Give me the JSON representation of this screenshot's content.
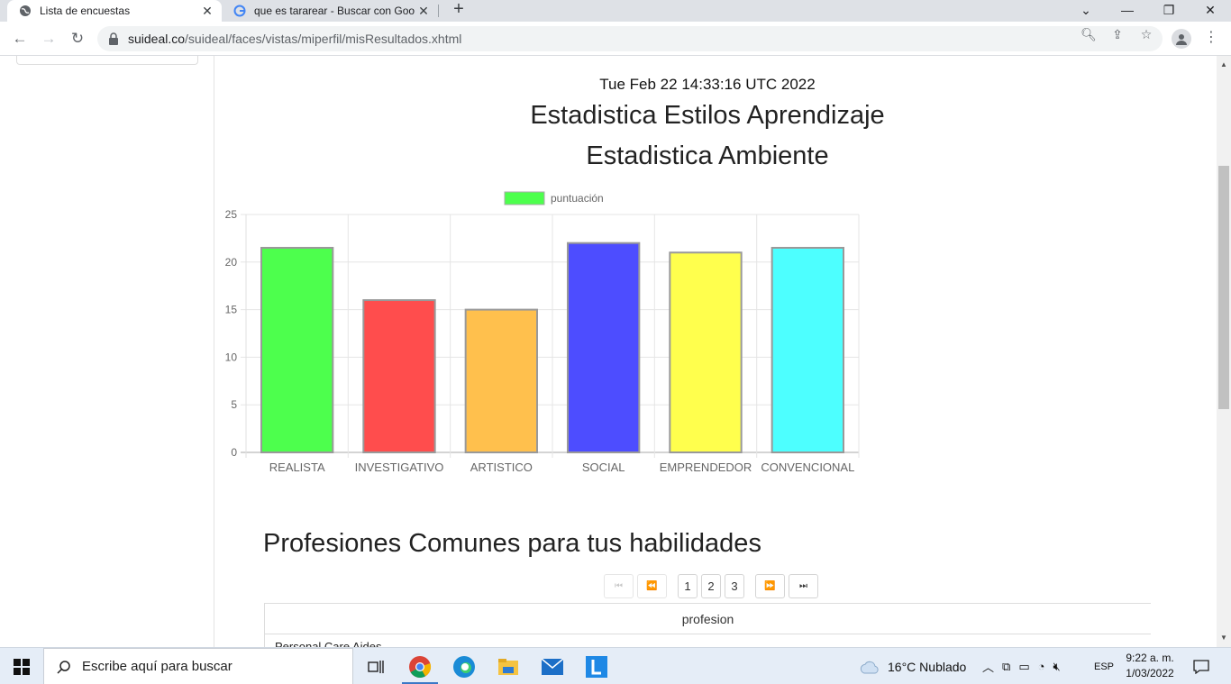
{
  "browser": {
    "tabs": [
      {
        "title": "Lista de encuestas",
        "active": true
      },
      {
        "title": "que es tararear - Buscar con Goo",
        "active": false
      }
    ],
    "url_domain": "suideal.co",
    "url_path": "/suideal/faces/vistas/miperfil/misResultados.xhtml"
  },
  "page": {
    "timestamp": "Tue Feb 22 14:33:16 UTC 2022",
    "title_learning": "Estadistica Estilos Aprendizaje",
    "title_environment": "Estadistica Ambiente",
    "professions_title": "Profesiones Comunes para tus habilidades",
    "paginator": {
      "first": "⏮",
      "prev": "⏪",
      "pages": [
        "1",
        "2",
        "3"
      ],
      "current_page": "1",
      "next": "⏩",
      "last": "⏭"
    },
    "table": {
      "header": "profesion",
      "rows": [
        "Personal Care Aides"
      ]
    }
  },
  "chart_data": {
    "type": "bar",
    "categories": [
      "REALISTA",
      "INVESTIGATIVO",
      "ARTISTICO",
      "SOCIAL",
      "EMPRENDEDOR",
      "CONVENCIONAL"
    ],
    "series": [
      {
        "name": "puntuación",
        "values": [
          21.5,
          16,
          15,
          22,
          21,
          21.5
        ]
      }
    ],
    "bar_colors": [
      "#4dff4d",
      "#ff4d4d",
      "#ffc04d",
      "#4d4dff",
      "#ffff4d",
      "#4dffff"
    ],
    "legend_color": "#4dff4d",
    "ylim": [
      0,
      25
    ],
    "yticks": [
      0,
      5,
      10,
      15,
      20,
      25
    ],
    "grid": true,
    "legend_position": "top"
  },
  "taskbar": {
    "search_placeholder": "Escribe aquí para buscar",
    "weather": "16°C  Nublado",
    "language": "ESP",
    "time": "9:22 a. m.",
    "date": "1/03/2022"
  }
}
